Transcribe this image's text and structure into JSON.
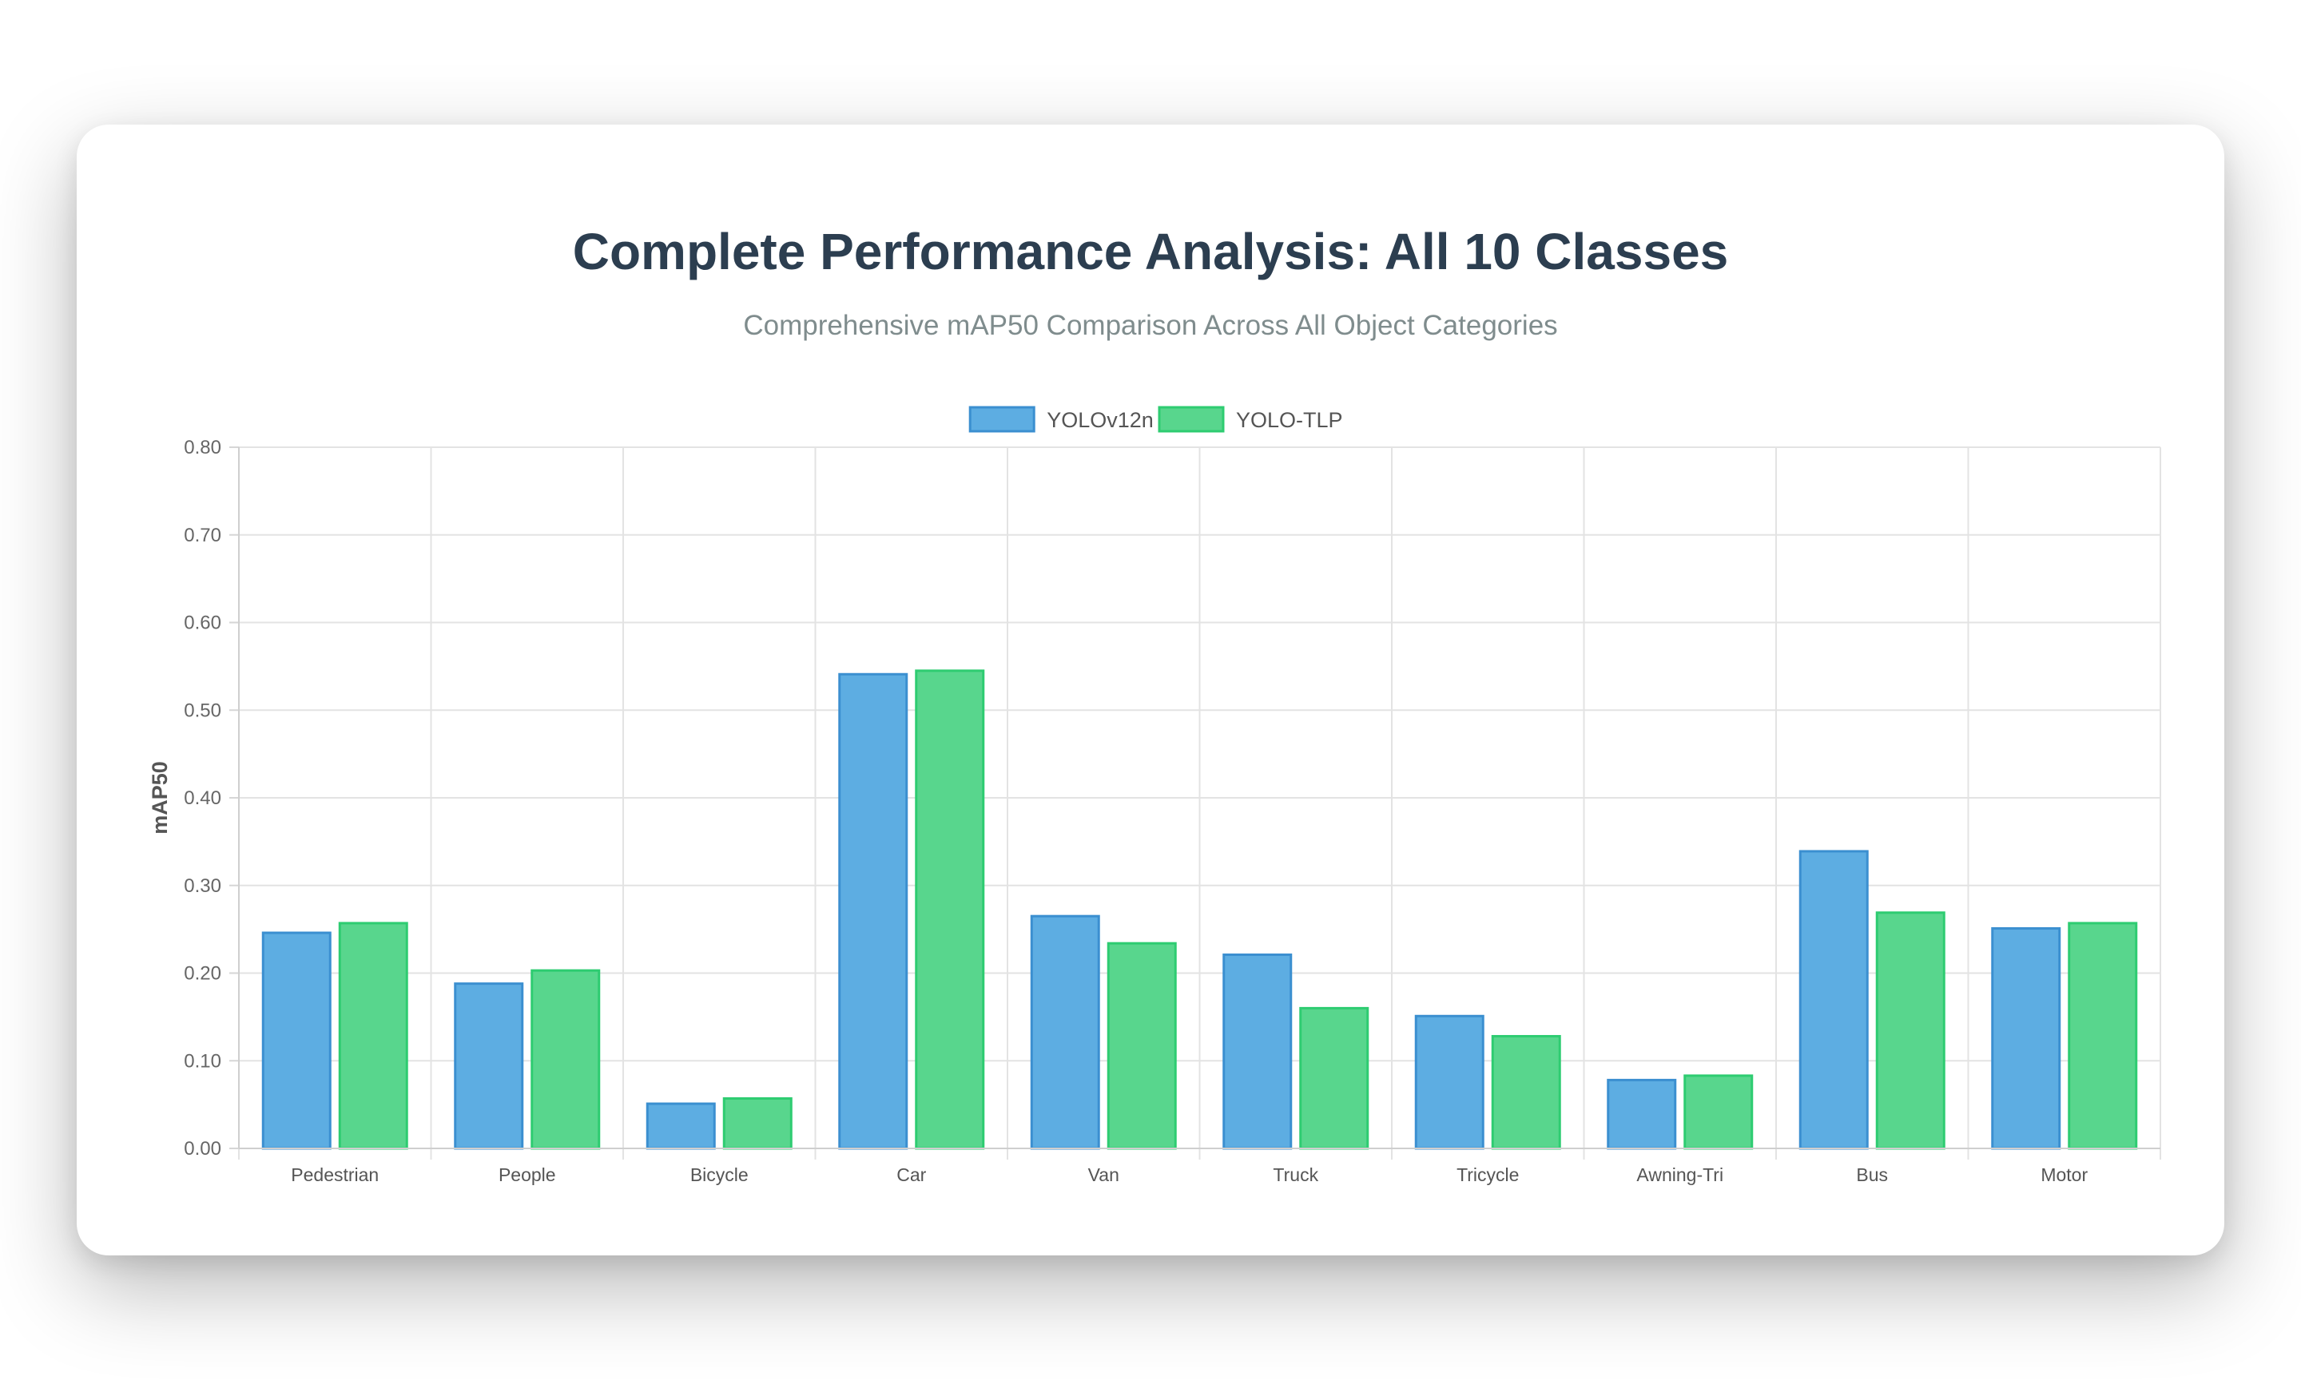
{
  "title": "Complete Performance Analysis: All 10 Classes",
  "subtitle": "Comprehensive mAP50 Comparison Across All Object Categories",
  "chart_data": {
    "type": "bar",
    "categories": [
      "Pedestrian",
      "People",
      "Bicycle",
      "Car",
      "Van",
      "Truck",
      "Tricycle",
      "Awning-Tri",
      "Bus",
      "Motor"
    ],
    "series": [
      {
        "name": "YOLOv12n",
        "color": "#5dade2",
        "border": "#3b8fd0",
        "values": [
          0.246,
          0.188,
          0.051,
          0.541,
          0.265,
          0.221,
          0.151,
          0.078,
          0.339,
          0.251
        ]
      },
      {
        "name": "YOLO-TLP",
        "color": "#58d68d",
        "border": "#2ecc71",
        "values": [
          0.257,
          0.203,
          0.057,
          0.545,
          0.234,
          0.16,
          0.128,
          0.083,
          0.269,
          0.257
        ]
      }
    ],
    "ylabel": "mAP50",
    "xlabel": "",
    "ylim": [
      0,
      0.8
    ],
    "yticks": [
      "0.00",
      "0.10",
      "0.20",
      "0.30",
      "0.40",
      "0.50",
      "0.60",
      "0.70",
      "0.80"
    ],
    "grid": true,
    "legend_position": "top-center"
  }
}
